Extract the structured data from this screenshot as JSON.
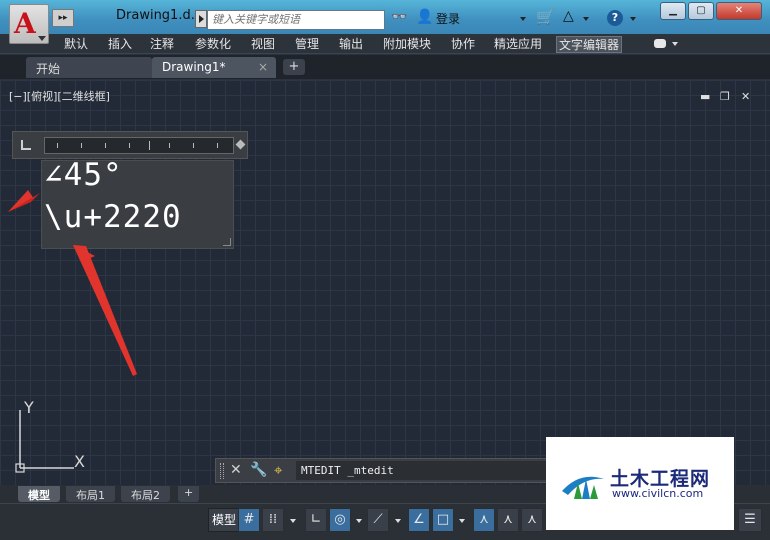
{
  "titlebar": {
    "app_letter": "A",
    "qa_label": "▸▸",
    "doc_title": "Drawing1.d...",
    "search_placeholder": "键入关键字或短语",
    "login_label": "登录",
    "help_label": "?"
  },
  "ribbon": {
    "tabs": [
      "默认",
      "插入",
      "注释",
      "参数化",
      "视图",
      "管理",
      "输出",
      "附加模块",
      "协作",
      "精选应用",
      "文字编辑器"
    ],
    "active_tab": "文字编辑器"
  },
  "doc_tabs": [
    {
      "label": "开始"
    },
    {
      "label": "Drawing1*",
      "close": "×"
    }
  ],
  "plus_label": "+",
  "viewport": {
    "label": "[−][俯视][二维线框]",
    "min": "▬",
    "restore": "❐",
    "close": "✕"
  },
  "editor": {
    "line1": "∠45°",
    "line2": "\\u+2220"
  },
  "ucs": {
    "y": "Y",
    "x": "X"
  },
  "command": {
    "close": "✕",
    "wrench": "🔧",
    "prompt_icon": "⌖",
    "value": "MTEDIT _mtedit"
  },
  "layout_tabs": [
    {
      "label": "模型",
      "active": true
    },
    {
      "label": "布局1"
    },
    {
      "label": "布局2"
    }
  ],
  "status": {
    "model_label": "模型",
    "menu_icon": "☰"
  },
  "watermark": {
    "title": "土木工程网",
    "url": "www.civilcn.com"
  },
  "colors": {
    "accent_red": "#e0342c",
    "watermark_blue": "#1c2a7a",
    "ribbon_active": "#4b525c"
  }
}
